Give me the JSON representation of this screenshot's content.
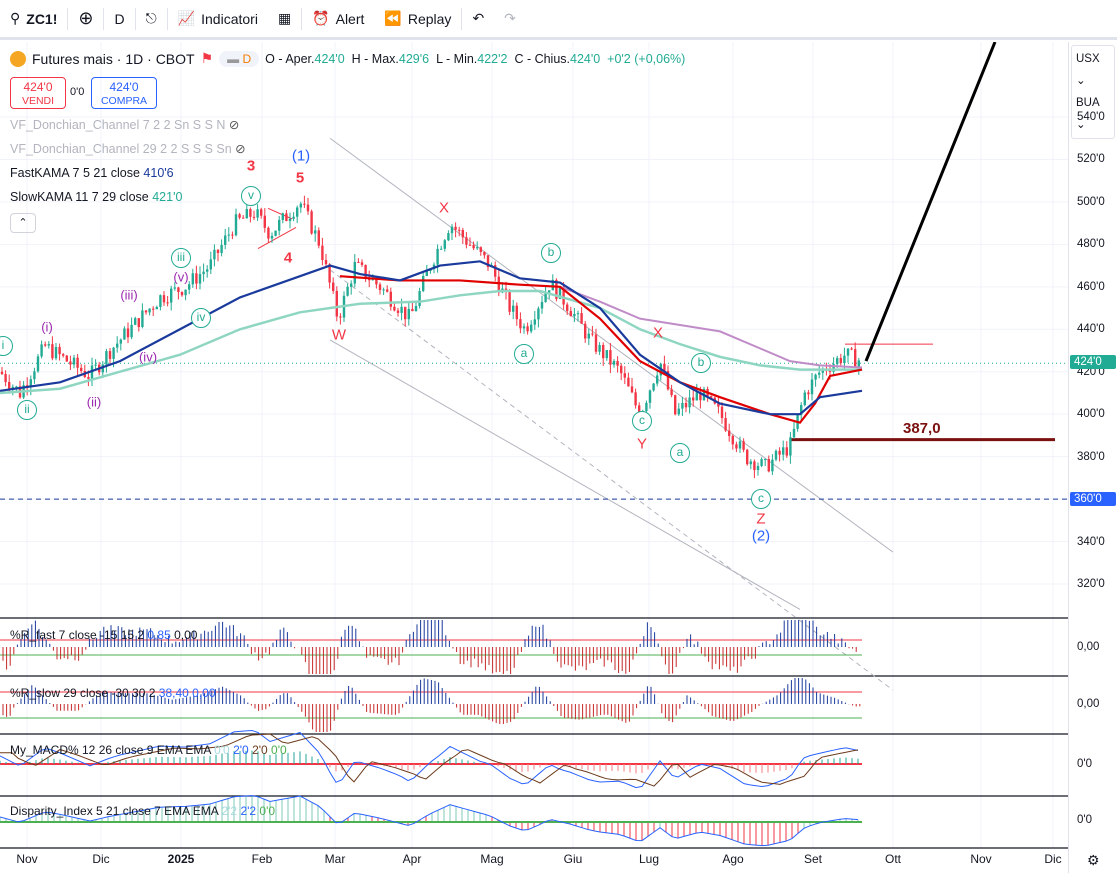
{
  "toolbar": {
    "symbol": "ZC1!",
    "interval": "D",
    "indicators": "Indicatori",
    "alert": "Alert",
    "replay": "Replay"
  },
  "legend": {
    "title": "Futures mais · 1D · CBOT",
    "d_badge": "D",
    "o_label": "O - Aper.",
    "o": "424'0",
    "h_label": "H - Max.",
    "h": "429'6",
    "l_label": "L - Min.",
    "l": "422'2",
    "c_label": "C - Chius.",
    "c": "424'0",
    "change": "+0'2 (+0,06%)"
  },
  "trade": {
    "sell_price": "424'0",
    "sell_label": "VENDI",
    "spread": "0'0",
    "buy_price": "424'0",
    "buy_label": "COMPRA"
  },
  "indicators": [
    {
      "name": "VF_Donchian_Channel 7 2 2 Sn S S N"
    },
    {
      "name": "VF_Donchian_Channel 29 2 2 S S S Sn"
    },
    {
      "name": "FastKAMA 7 5 21 close",
      "value": "410'6"
    },
    {
      "name": "SlowKAMA 11 7 29 close",
      "value": "421'0"
    }
  ],
  "panes": [
    {
      "title": "%R_fast 7 close -15 15 2",
      "v1": "0,85",
      "v2": "0,00",
      "axis": "0,00"
    },
    {
      "title": "%R_slow 29 close -30 30 2",
      "v1": "38,40",
      "v2": "0,00",
      "axis": "0,00"
    },
    {
      "title": "My_MACD% 12 26 close 9 EMA EMA",
      "v1": "0'0",
      "v2": "2'0",
      "v3": "2'0",
      "v4": "0'0",
      "axis": "0'0"
    },
    {
      "title": "Disparity_Index 5 21 close 7 EMA EMA",
      "v1": "2'2",
      "v2": "2'2",
      "v3": "0'0",
      "axis": "0'0"
    }
  ],
  "price_axis": {
    "currency": "USX",
    "unit": "BUA",
    "ticks": [
      "540'0",
      "520'0",
      "500'0",
      "480'0",
      "460'0",
      "440'0",
      "420'0",
      "400'0",
      "380'0",
      "360'0",
      "340'0",
      "320'0"
    ],
    "last_price": "424'0",
    "line_price": "360'0"
  },
  "time_axis": [
    "Nov",
    "Dic",
    "2025",
    "Feb",
    "Mar",
    "Apr",
    "Mag",
    "Giu",
    "Lug",
    "Ago",
    "Set",
    "Ott",
    "Nov",
    "Dic"
  ],
  "annotations": {
    "level": "387,0",
    "waves": [
      "(1)",
      "(2)",
      "3",
      "5",
      "4",
      "X",
      "W",
      "X",
      "Y",
      "Z",
      "i",
      "ii",
      "(i)",
      "(ii)",
      "(iii)",
      "(iv)",
      "(v)",
      "iii",
      "iv",
      "v",
      "a",
      "b",
      "c",
      "a",
      "b",
      "c"
    ]
  },
  "chart_data": {
    "type": "candlestick",
    "ylim": [
      310,
      550
    ],
    "price_path": [
      [
        0,
        420
      ],
      [
        20,
        410
      ],
      [
        45,
        432
      ],
      [
        90,
        418
      ],
      [
        110,
        430
      ],
      [
        130,
        440
      ],
      [
        160,
        455
      ],
      [
        185,
        460
      ],
      [
        210,
        470
      ],
      [
        235,
        490
      ],
      [
        255,
        495
      ],
      [
        270,
        485
      ],
      [
        300,
        500
      ],
      [
        320,
        480
      ],
      [
        338,
        445
      ],
      [
        355,
        470
      ],
      [
        380,
        460
      ],
      [
        410,
        445
      ],
      [
        430,
        470
      ],
      [
        450,
        490
      ],
      [
        470,
        480
      ],
      [
        490,
        470
      ],
      [
        510,
        450
      ],
      [
        525,
        440
      ],
      [
        550,
        462
      ],
      [
        570,
        450
      ],
      [
        590,
        435
      ],
      [
        620,
        420
      ],
      [
        640,
        400
      ],
      [
        660,
        425
      ],
      [
        675,
        400
      ],
      [
        700,
        410
      ],
      [
        720,
        400
      ],
      [
        745,
        380
      ],
      [
        765,
        375
      ],
      [
        790,
        385
      ],
      [
        805,
        410
      ],
      [
        820,
        420
      ],
      [
        845,
        428
      ],
      [
        862,
        425
      ]
    ],
    "fast_kama": [
      [
        0,
        411
      ],
      [
        60,
        415
      ],
      [
        120,
        425
      ],
      [
        180,
        440
      ],
      [
        240,
        455
      ],
      [
        300,
        465
      ],
      [
        330,
        470
      ],
      [
        360,
        466
      ],
      [
        400,
        463
      ],
      [
        440,
        470
      ],
      [
        480,
        472
      ],
      [
        520,
        464
      ],
      [
        560,
        462
      ],
      [
        600,
        450
      ],
      [
        640,
        428
      ],
      [
        680,
        415
      ],
      [
        720,
        405
      ],
      [
        770,
        400
      ],
      [
        800,
        400
      ],
      [
        820,
        408
      ],
      [
        862,
        411
      ]
    ],
    "slow_kama": [
      [
        0,
        410
      ],
      [
        60,
        412
      ],
      [
        120,
        420
      ],
      [
        180,
        428
      ],
      [
        240,
        440
      ],
      [
        300,
        448
      ],
      [
        360,
        452
      ],
      [
        420,
        453
      ],
      [
        460,
        456
      ],
      [
        500,
        458
      ],
      [
        540,
        458
      ],
      [
        600,
        450
      ],
      [
        640,
        440
      ],
      [
        680,
        433
      ],
      [
        720,
        427
      ],
      [
        760,
        423
      ],
      [
        800,
        421
      ],
      [
        862,
        421
      ]
    ],
    "red_line": [
      [
        340,
        465
      ],
      [
        400,
        463
      ],
      [
        460,
        463
      ],
      [
        520,
        461
      ],
      [
        560,
        460
      ],
      [
        600,
        445
      ],
      [
        640,
        425
      ],
      [
        680,
        415
      ],
      [
        720,
        408
      ],
      [
        770,
        400
      ],
      [
        800,
        396
      ],
      [
        815,
        405
      ],
      [
        830,
        418
      ],
      [
        862,
        421
      ]
    ],
    "pink_line": [
      [
        560,
        460
      ],
      [
        600,
        453
      ],
      [
        640,
        445
      ],
      [
        680,
        442
      ],
      [
        720,
        439
      ],
      [
        760,
        431
      ],
      [
        790,
        425
      ],
      [
        820,
        423
      ],
      [
        862,
        422
      ]
    ],
    "accent": "#2962ff",
    "up": "#22ab94",
    "down": "#f23645"
  }
}
